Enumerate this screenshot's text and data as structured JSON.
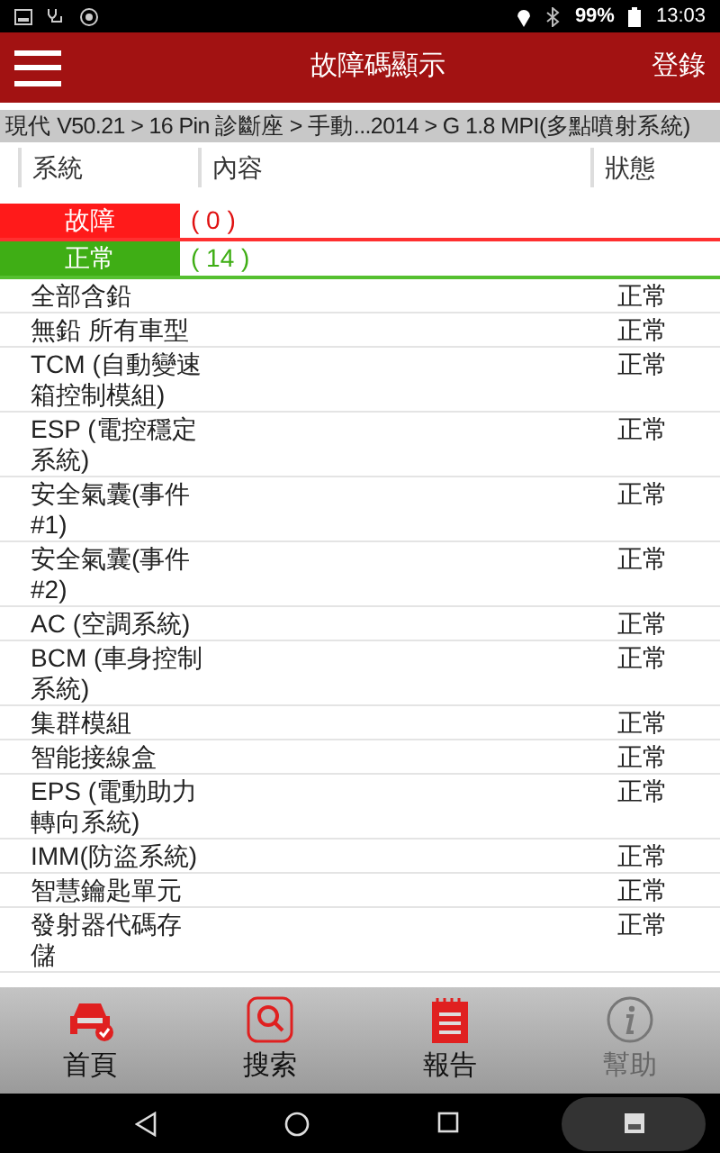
{
  "status_bar": {
    "battery": "99%",
    "time": "13:03"
  },
  "header": {
    "title": "故障碼顯示",
    "action": "登錄"
  },
  "breadcrumb": "現代 V50.21 > 16 Pin 診斷座 > 手動...2014 > G 1.8 MPI(多點噴射系統)",
  "columns": [
    "系統",
    "內容",
    "狀態"
  ],
  "summary": [
    {
      "kind": "fault",
      "label": "故障",
      "count": "( 0 )"
    },
    {
      "kind": "normal",
      "label": "正常",
      "count": "( 14 )"
    }
  ],
  "rows": [
    {
      "system": "全部含鉛",
      "status": "正常"
    },
    {
      "system": "無鉛 所有車型",
      "status": "正常"
    },
    {
      "system": "TCM (自動變速箱控制模組)",
      "status": "正常"
    },
    {
      "system": "ESP (電控穩定系統)",
      "status": "正常"
    },
    {
      "system": "安全氣囊(事件#1)",
      "status": "正常"
    },
    {
      "system": "安全氣囊(事件#2)",
      "status": "正常"
    },
    {
      "system": "AC (空調系統)",
      "status": "正常"
    },
    {
      "system": "BCM (車身控制系統)",
      "status": "正常"
    },
    {
      "system": "集群模組",
      "status": "正常"
    },
    {
      "system": "智能接線盒",
      "status": "正常"
    },
    {
      "system": "EPS (電動助力轉向系統)",
      "status": "正常"
    },
    {
      "system": "IMM(防盜系統)",
      "status": "正常"
    },
    {
      "system": "智慧鑰匙單元",
      "status": "正常"
    },
    {
      "system": "發射器代碼存儲",
      "status": "正常"
    }
  ],
  "bottom_nav": [
    {
      "kind": "home",
      "label": "首頁",
      "disabled": false
    },
    {
      "kind": "search",
      "label": "搜索",
      "disabled": false
    },
    {
      "kind": "report",
      "label": "報告",
      "disabled": false
    },
    {
      "kind": "help",
      "label": "幫助",
      "disabled": true
    }
  ]
}
